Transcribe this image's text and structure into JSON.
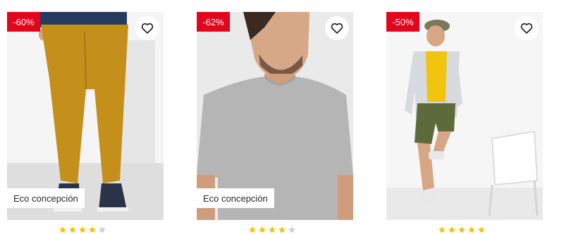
{
  "products": [
    {
      "discount": "-60%",
      "tag": "Eco concepción",
      "favorite_icon": "heart-outline-icon",
      "photo_subject": "mustard chino trousers with navy sneakers",
      "rating": 4,
      "rating_max": 5
    },
    {
      "discount": "-62%",
      "tag": "Eco concepción",
      "favorite_icon": "heart-outline-icon",
      "photo_subject": "heather grey crew neck t-shirt",
      "rating": 4,
      "rating_max": 5
    },
    {
      "discount": "-50%",
      "favorite_icon": "heart-outline-icon",
      "photo_subject": "olive green shorts with yellow tee and open shirt",
      "rating": 5,
      "rating_max": 5
    }
  ],
  "colors": {
    "badge_bg": "#e3051b",
    "badge_text": "#ffffff",
    "star_filled": "#f6c400",
    "star_empty": "#d0d0d0"
  }
}
